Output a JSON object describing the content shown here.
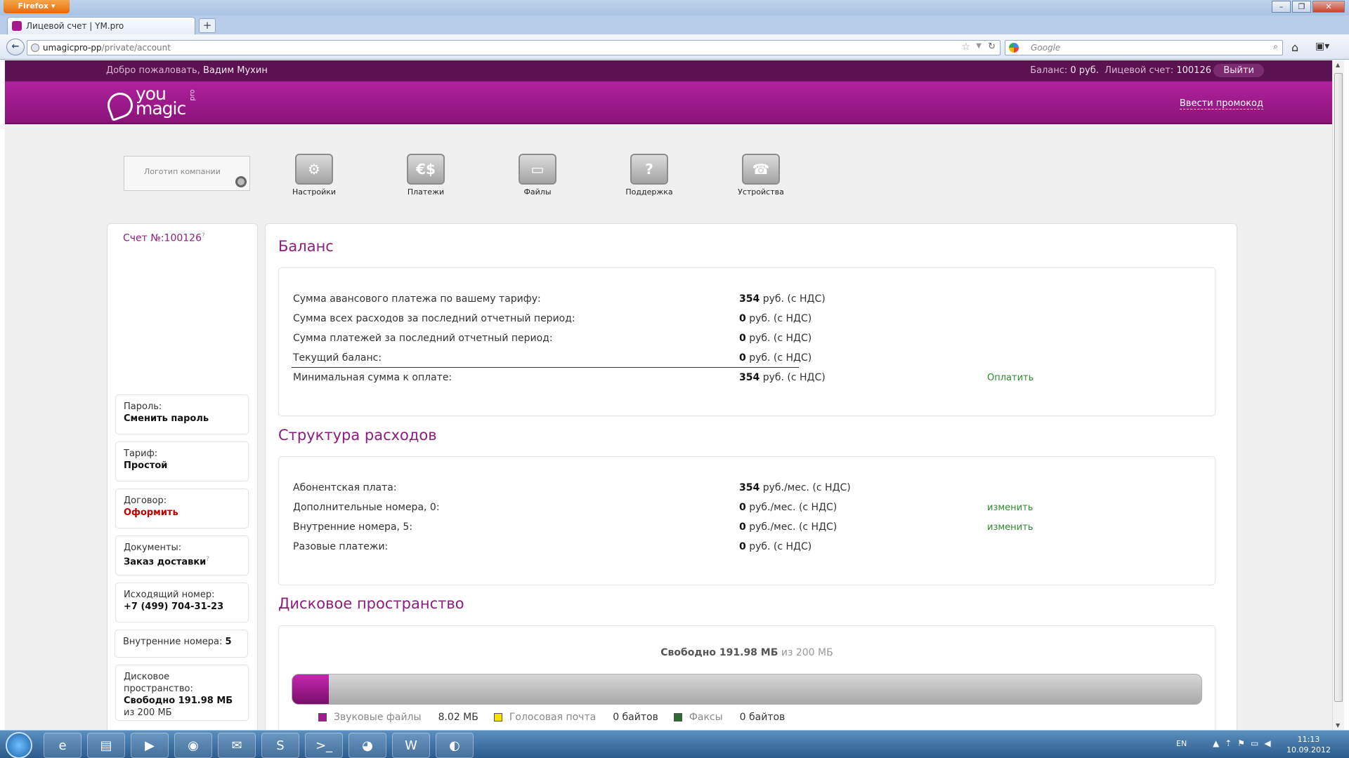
{
  "browser": {
    "menu_label": "Firefox",
    "tab_title": "Лицевой счет | YM.pro",
    "new_tab_symbol": "+",
    "url_host": "umagicpro-pp",
    "url_path": "/private/account",
    "search_placeholder": "Google",
    "window_buttons": [
      "–",
      "❐",
      "✕"
    ]
  },
  "topbar": {
    "welcome_prefix": "Добро пожаловать,",
    "user_name": "Вадим Мухин",
    "balance_label": "Баланс:",
    "balance_value": "0 руб.",
    "account_label": "Лицевой счет:",
    "account_value": "100126",
    "logout_label": "Выйти"
  },
  "header": {
    "logo_line1": "you",
    "logo_line2": "magic",
    "logo_suffix": "pro",
    "promo_link": "Ввести промокод"
  },
  "company_logo_placeholder": "Логотип компании",
  "nav_icons": [
    {
      "label": "Настройки",
      "icon": "settings-gears-icon",
      "glyph": "⚙"
    },
    {
      "label": "Платежи",
      "icon": "payments-euro-dollar-icon",
      "glyph": "€$"
    },
    {
      "label": "Файлы",
      "icon": "files-folder-icon",
      "glyph": "▭"
    },
    {
      "label": "Поддержка",
      "icon": "support-question-icon",
      "glyph": "?"
    },
    {
      "label": "Устройства",
      "icon": "devices-phone-icon",
      "glyph": "☎"
    }
  ],
  "sidebar": {
    "account_number": "Счет №:100126",
    "help_mark": "?",
    "items": [
      {
        "label": "Пароль:",
        "value": "Сменить пароль"
      },
      {
        "label": "Тариф:",
        "value": "Простой"
      },
      {
        "label": "Договор:",
        "value": "Оформить"
      },
      {
        "label": "Документы:",
        "value": "Заказ доставки"
      },
      {
        "label": "Исходящий номер:",
        "value": "+7 (499) 704-31-23"
      },
      {
        "label": "Внутренние номера:",
        "value": "5"
      },
      {
        "label": "Дисковое пространство:",
        "value": "Свободно 191.98 МБ",
        "extra": "из 200 МБ"
      }
    ]
  },
  "balance": {
    "title": "Баланс",
    "rows": [
      {
        "label": "Сумма авансового платежа по вашему тарифу:",
        "amount": "354",
        "unit": "руб. (с НДС)"
      },
      {
        "label": "Сумма всех расходов за последний отчетный период:",
        "amount": "0",
        "unit": "руб. (с НДС)"
      },
      {
        "label": "Сумма платежей за последний отчетный период:",
        "amount": "0",
        "unit": "руб. (с НДС)"
      },
      {
        "label": "Текущий баланс:",
        "amount": "0",
        "unit": "руб. (с НДС)"
      },
      {
        "label": "Минимальная сумма к оплате:",
        "amount": "354",
        "unit": "руб. (с НДС)",
        "action": "Оплатить"
      }
    ]
  },
  "expenses": {
    "title": "Структура расходов",
    "rows": [
      {
        "label": "Абонентская плата:",
        "amount": "354",
        "unit": "руб./мес. (с НДС)"
      },
      {
        "label": "Дополнительные номера, 0:",
        "amount": "0",
        "unit": "руб./мес. (с НДС)",
        "action": "изменить"
      },
      {
        "label": "Внутренние номера, 5:",
        "amount": "0",
        "unit": "руб./мес. (с НДС)",
        "action": "изменить"
      },
      {
        "label": "Разовые платежи:",
        "amount": "0",
        "unit": "руб. (с НДС)"
      }
    ]
  },
  "disk": {
    "title": "Дисковое пространство",
    "free_label": "Свободно 191.98 МБ",
    "total_label": "из 200 МБ",
    "used_fraction": 0.04,
    "legend": [
      {
        "label": "Звуковые файлы",
        "value": "8.02 МБ",
        "color": "#a6188f"
      },
      {
        "label": "Голосовая почта",
        "value": "0 байтов",
        "color": "#f5e000"
      },
      {
        "label": "Факсы",
        "value": "0 байтов",
        "color": "#2e6b2e"
      }
    ]
  },
  "taskbar": {
    "apps": [
      {
        "icon": "internet-explorer-icon",
        "glyph": "e"
      },
      {
        "icon": "file-explorer-icon",
        "glyph": "▤"
      },
      {
        "icon": "media-player-icon",
        "glyph": "▶"
      },
      {
        "icon": "firefox-icon",
        "glyph": "◉"
      },
      {
        "icon": "mail-icon",
        "glyph": "✉"
      },
      {
        "icon": "skype-icon",
        "glyph": "S"
      },
      {
        "icon": "terminal-icon",
        "glyph": ">_"
      },
      {
        "icon": "github-icon",
        "glyph": "◕"
      },
      {
        "icon": "word-icon",
        "glyph": "W"
      },
      {
        "icon": "eclipse-icon",
        "glyph": "◐"
      }
    ],
    "language": "EN",
    "time": "11:13",
    "date": "10.09.2012"
  },
  "colors": {
    "brand": "#8c1f7d",
    "action_green": "#2c8a2e",
    "warning_red": "#c00000"
  }
}
